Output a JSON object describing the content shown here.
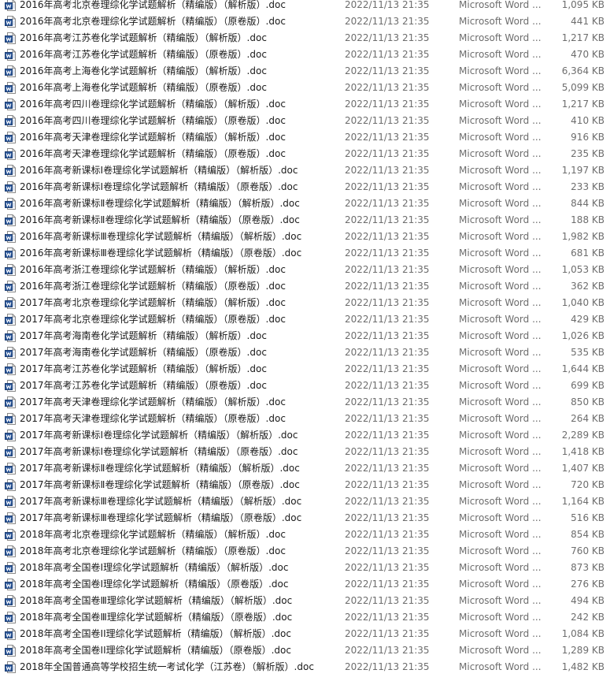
{
  "files": [
    {
      "name": "2016年高考北京卷理综化学试题解析（精编版）（解析版）.doc",
      "date": "2022/11/13 21:35",
      "type": "Microsoft Word ...",
      "size": "1,095 KB"
    },
    {
      "name": "2016年高考北京卷理综化学试题解析（精编版）（原卷版）.doc",
      "date": "2022/11/13 21:35",
      "type": "Microsoft Word ...",
      "size": "441 KB"
    },
    {
      "name": "2016年高考江苏卷化学试题解析（精编版）（解析版）.doc",
      "date": "2022/11/13 21:35",
      "type": "Microsoft Word ...",
      "size": "1,217 KB"
    },
    {
      "name": "2016年高考江苏卷化学试题解析（精编版）（原卷版）.doc",
      "date": "2022/11/13 21:35",
      "type": "Microsoft Word ...",
      "size": "470 KB"
    },
    {
      "name": "2016年高考上海卷化学试题解析（精编版）（解析版）.doc",
      "date": "2022/11/13 21:35",
      "type": "Microsoft Word ...",
      "size": "6,364 KB"
    },
    {
      "name": "2016年高考上海卷化学试题解析（精编版）（原卷版）.doc",
      "date": "2022/11/13 21:35",
      "type": "Microsoft Word ...",
      "size": "5,099 KB"
    },
    {
      "name": "2016年高考四川卷理综化学试题解析（精编版）（解析版）.doc",
      "date": "2022/11/13 21:35",
      "type": "Microsoft Word ...",
      "size": "1,217 KB"
    },
    {
      "name": "2016年高考四川卷理综化学试题解析（精编版）（原卷版）.doc",
      "date": "2022/11/13 21:35",
      "type": "Microsoft Word ...",
      "size": "410 KB"
    },
    {
      "name": "2016年高考天津卷理综化学试题解析（精编版）（解析版）.doc",
      "date": "2022/11/13 21:35",
      "type": "Microsoft Word ...",
      "size": "916 KB"
    },
    {
      "name": "2016年高考天津卷理综化学试题解析（精编版）（原卷版）.doc",
      "date": "2022/11/13 21:35",
      "type": "Microsoft Word ...",
      "size": "235 KB"
    },
    {
      "name": "2016年高考新课标Ⅰ卷理综化学试题解析（精编版）（解析版）.doc",
      "date": "2022/11/13 21:35",
      "type": "Microsoft Word ...",
      "size": "1,197 KB"
    },
    {
      "name": "2016年高考新课标Ⅰ卷理综化学试题解析（精编版）（原卷版）.doc",
      "date": "2022/11/13 21:35",
      "type": "Microsoft Word ...",
      "size": "233 KB"
    },
    {
      "name": "2016年高考新课标Ⅱ卷理综化学试题解析（精编版）（解析版）.doc",
      "date": "2022/11/13 21:35",
      "type": "Microsoft Word ...",
      "size": "844 KB"
    },
    {
      "name": "2016年高考新课标Ⅱ卷理综化学试题解析（精编版）（原卷版）.doc",
      "date": "2022/11/13 21:35",
      "type": "Microsoft Word ...",
      "size": "188 KB"
    },
    {
      "name": "2016年高考新课标Ⅲ卷理综化学试题解析（精编版）（解析版）.doc",
      "date": "2022/11/13 21:35",
      "type": "Microsoft Word ...",
      "size": "1,982 KB"
    },
    {
      "name": "2016年高考新课标Ⅲ卷理综化学试题解析（精编版）（原卷版）.doc",
      "date": "2022/11/13 21:35",
      "type": "Microsoft Word ...",
      "size": "681 KB"
    },
    {
      "name": "2016年高考浙江卷理综化学试题解析（精编版）（解析版）.doc",
      "date": "2022/11/13 21:35",
      "type": "Microsoft Word ...",
      "size": "1,053 KB"
    },
    {
      "name": "2016年高考浙江卷理综化学试题解析（精编版）（原卷版）.doc",
      "date": "2022/11/13 21:35",
      "type": "Microsoft Word ...",
      "size": "362 KB"
    },
    {
      "name": "2017年高考北京卷理综化学试题解析（精编版）（解析版）.doc",
      "date": "2022/11/13 21:35",
      "type": "Microsoft Word ...",
      "size": "1,040 KB"
    },
    {
      "name": "2017年高考北京卷理综化学试题解析（精编版）（原卷版）.doc",
      "date": "2022/11/13 21:35",
      "type": "Microsoft Word ...",
      "size": "429 KB"
    },
    {
      "name": "2017年高考海南卷化学试题解析（精编版）（解析版）.doc",
      "date": "2022/11/13 21:35",
      "type": "Microsoft Word ...",
      "size": "1,026 KB"
    },
    {
      "name": "2017年高考海南卷化学试题解析（精编版）（原卷版）.doc",
      "date": "2022/11/13 21:35",
      "type": "Microsoft Word ...",
      "size": "535 KB"
    },
    {
      "name": "2017年高考江苏卷化学试题解析（精编版）（解析版）.doc",
      "date": "2022/11/13 21:35",
      "type": "Microsoft Word ...",
      "size": "1,644 KB"
    },
    {
      "name": "2017年高考江苏卷化学试题解析（精编版）（原卷版）.doc",
      "date": "2022/11/13 21:35",
      "type": "Microsoft Word ...",
      "size": "699 KB"
    },
    {
      "name": "2017年高考天津卷理综化学试题解析（精编版）（解析版）.doc",
      "date": "2022/11/13 21:35",
      "type": "Microsoft Word ...",
      "size": "850 KB"
    },
    {
      "name": "2017年高考天津卷理综化学试题解析（精编版）（原卷版）.doc",
      "date": "2022/11/13 21:35",
      "type": "Microsoft Word ...",
      "size": "264 KB"
    },
    {
      "name": "2017年高考新课标Ⅰ卷理综化学试题解析（精编版）（解析版）.doc",
      "date": "2022/11/13 21:35",
      "type": "Microsoft Word ...",
      "size": "2,289 KB"
    },
    {
      "name": "2017年高考新课标Ⅰ卷理综化学试题解析（精编版）（原卷版）.doc",
      "date": "2022/11/13 21:35",
      "type": "Microsoft Word ...",
      "size": "1,418 KB"
    },
    {
      "name": "2017年高考新课标Ⅱ卷理综化学试题解析（精编版）（解析版）.doc",
      "date": "2022/11/13 21:35",
      "type": "Microsoft Word ...",
      "size": "1,407 KB"
    },
    {
      "name": "2017年高考新课标Ⅱ卷理综化学试题解析（精编版）（原卷版）.doc",
      "date": "2022/11/13 21:35",
      "type": "Microsoft Word ...",
      "size": "720 KB"
    },
    {
      "name": "2017年高考新课标Ⅲ卷理综化学试题解析（精编版）（解析版）.doc",
      "date": "2022/11/13 21:35",
      "type": "Microsoft Word ...",
      "size": "1,164 KB"
    },
    {
      "name": "2017年高考新课标Ⅲ卷理综化学试题解析（精编版）（原卷版）.doc",
      "date": "2022/11/13 21:35",
      "type": "Microsoft Word ...",
      "size": "516 KB"
    },
    {
      "name": "2018年高考北京卷理综化学试题解析（精编版）（解析版）.doc",
      "date": "2022/11/13 21:35",
      "type": "Microsoft Word ...",
      "size": "854 KB"
    },
    {
      "name": "2018年高考北京卷理综化学试题解析（精编版）（原卷版）.doc",
      "date": "2022/11/13 21:35",
      "type": "Microsoft Word ...",
      "size": "760 KB"
    },
    {
      "name": "2018年高考全国卷Ⅰ理综化学试题解析（精编版）（解析版）.doc",
      "date": "2022/11/13 21:35",
      "type": "Microsoft Word ...",
      "size": "873 KB"
    },
    {
      "name": "2018年高考全国卷Ⅰ理综化学试题解析（精编版）（原卷版）.doc",
      "date": "2022/11/13 21:35",
      "type": "Microsoft Word ...",
      "size": "276 KB"
    },
    {
      "name": "2018年高考全国卷Ⅲ理综化学试题解析（精编版）（解析版）.doc",
      "date": "2022/11/13 21:35",
      "type": "Microsoft Word ...",
      "size": "494 KB"
    },
    {
      "name": "2018年高考全国卷Ⅲ理综化学试题解析（精编版）（原卷版）.doc",
      "date": "2022/11/13 21:35",
      "type": "Microsoft Word ...",
      "size": "242 KB"
    },
    {
      "name": "2018年高考全国卷II理综化学试题解析（精编版）（解析版）.doc",
      "date": "2022/11/13 21:35",
      "type": "Microsoft Word ...",
      "size": "1,084 KB"
    },
    {
      "name": "2018年高考全国卷II理综化学试题解析（精编版）（原卷版）.doc",
      "date": "2022/11/13 21:35",
      "type": "Microsoft Word ...",
      "size": "1,289 KB"
    },
    {
      "name": "2018年全国普通高等学校招生统一考试化学（江苏卷）（解析版）.doc",
      "date": "2022/11/13 21:35",
      "type": "Microsoft Word ...",
      "size": "1,482 KB"
    }
  ]
}
